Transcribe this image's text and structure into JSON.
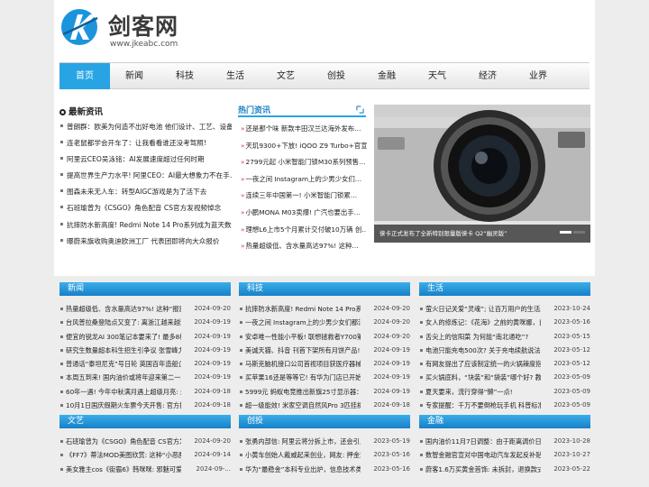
{
  "site": {
    "name": "剑客网",
    "url": "www.jkeabc.com"
  },
  "colors": {
    "accent": "#28a4e4",
    "panel_header": "#1f8fd6"
  },
  "nav": [
    "首页",
    "新闻",
    "科技",
    "生活",
    "文艺",
    "创投",
    "金融",
    "天气",
    "经济",
    "业界"
  ],
  "latest": {
    "title": "最新资讯",
    "items": [
      "普朗群：欧美为何造不出好电池 他们设计、工艺、设备…",
      "连老鼠都学会开车了：让我看看谁还没考驾照!",
      "阿里云CEO吴泳铭：AI发展速度超过任何时期",
      "提高世界生产力水平! 阿里CEO：AI最大想象力不在手…",
      "图森未来无人车：转型AIGC游戏是为了活下去",
      "石班瑜曾为《CSGO》角色配音 CS官方发视频悼念",
      "抗摔防水新高度! Redmi Note 14 Pro系列成为蓝天数据官…",
      "曝蔚来旗收购奥迪欧洲工厂 代表团即将向大众报价"
    ]
  },
  "hot": {
    "title": "热门资讯",
    "items": [
      "还是那个味 新款丰田汉兰达海外发布…",
      "天玑9300+下放! iQOO Z9 Turbo+官宣…",
      "2799元起 小米智能门锁M30系列预售…",
      "一夜之间 Instagram上的少男少女们…",
      "连续三年中国第一! 小米智能门锁累…",
      "小鹏MONA M03卖爆! 广汽也要出手…",
      "理想L6上市5个月累计交付破10万辆 创…",
      "热量超级低、含水量高达97%! 这种…"
    ]
  },
  "slider": {
    "caption": "徕卡正式发布了全新特别限量版徕卡 Q2“幽灵版”"
  },
  "panels": [
    {
      "title": "新闻",
      "items": [
        {
          "t": "热量超级低、含水量高达97%! 这种“报恩”蔬菜…",
          "d": "2024-09-20"
        },
        {
          "t": "台风普拉桑登陆点又变了: 离浙江越来越近",
          "d": "2024-09-19"
        },
        {
          "t": "便宜的锐龙AI 300笔记本要来了! 最多8核CPU、…",
          "d": "2024-09-19"
        },
        {
          "t": "研究生数量超本科生招生引争议 张雪峰力挺兰大",
          "d": "2024-09-19"
        },
        {
          "t": "普通话“泰坦尼克”号日轮 英国百年造船企业哈兰…",
          "d": "2024-09-19"
        },
        {
          "t": "本周五到来! 国内油价或将年迎来第二一次下调…",
          "d": "2024-09-19"
        },
        {
          "t": "60年一遇! 今年中秋满月遇上超级月亮: 最值赏…",
          "d": "2024-09-18"
        },
        {
          "t": "10月1日国庆假期火车票今天开售: 官方提醒以准…",
          "d": "2024-09-18"
        }
      ]
    },
    {
      "title": "科技",
      "items": [
        {
          "t": "抗摔防水新高度! Redmi Note 14 Pro系列成为蓝…",
          "d": "2024-09-20"
        },
        {
          "t": "一夜之间 Instagram上的少男少女们都消失了",
          "d": "2024-09-20"
        },
        {
          "t": "安卓唯一性能小平板! 联想拯救者Y700第三代来…",
          "d": "2024-09-20"
        },
        {
          "t": "美诚天猫、抖音 刊首下架所有月饼产品! 罗永浩道…",
          "d": "2024-09-19"
        },
        {
          "t": "马斯克脑机接口公司首视项目获医疗器械认证…",
          "d": "2024-09-19"
        },
        {
          "t": "买苹果16还是等等它! 有华为门店已开始接受Mate…",
          "d": "2024-09-19"
        },
        {
          "t": "5999元 蚂蚁电竞推出新旗25寸显示器：540Hz超…",
          "d": "2024-09-19"
        },
        {
          "t": "超一级能效! 米家空调自然风Pro 3匹挂机空调今…",
          "d": "2024-09-18"
        }
      ]
    },
    {
      "title": "生活",
      "items": [
        {
          "t": "萤火日记关爱“灵魂”; 让百万用户的生活乐趣模…",
          "d": "2023-10-24"
        },
        {
          "t": "女人的修炼记：《花海》之前的黄咪娜，自卑落…",
          "d": "2023-05-16"
        },
        {
          "t": "舌尖上的信阳菜 为何能“南北通吃”?",
          "d": "2023-05-15"
        },
        {
          "t": "电池只能充电500次? 关于充电续航说法有真假…",
          "d": "2023-05-12"
        },
        {
          "t": "有网友提出了应该制定统一的火锅辣度指数的建议…",
          "d": "2023-05-12"
        },
        {
          "t": "买火锅底料，“块装”和“袋装”哪个好? 教你挑选…",
          "d": "2023-05-09"
        },
        {
          "t": "夏天要来，流行穿得“懒”一点!",
          "d": "2023-05-09"
        },
        {
          "t": "专家提醒：千万不要倒枪玩手机 科普标准姿势",
          "d": "2023-05-09"
        }
      ]
    },
    {
      "title": "文艺",
      "items": [
        {
          "t": "石班瑜曾为《CSGO》角色配音 CS官方发视频悼念",
          "d": "2024-09-20"
        },
        {
          "t": "《FF7》蒂法MOD美图欣赏: 这种“小恶魔”你爱吗?",
          "d": "2024-09-14"
        },
        {
          "t": "美女雅主cos《街霸6》韩咪咪: 邪魅可爱身姿妖娆",
          "d": "2024-09-..."
        }
      ]
    },
    {
      "title": "创投",
      "items": [
        {
          "t": "张勇内部信: 阿里云将分拆上市，还会引入外部…",
          "d": "2023-05-19"
        },
        {
          "t": "小黄车创始人戴威起来创业，网友: 押金退了吗?",
          "d": "2023-05-16"
        },
        {
          "t": "华为“最稳金”本科专业出炉，信息技术类包揽前…",
          "d": "2023-05-16"
        }
      ]
    },
    {
      "title": "金融",
      "items": [
        {
          "t": "国内油价11月7日调整：由于距离调价日期较远，…",
          "d": "2023-10-28"
        },
        {
          "t": "数智金融官宣对中国电动汽车发起反补贴调查，涉及…",
          "d": "2023-10-27"
        },
        {
          "t": "蔚客1.6万买黄金首饰: 未拆封，退换款式均要按…",
          "d": "2023-05-22"
        }
      ]
    }
  ]
}
